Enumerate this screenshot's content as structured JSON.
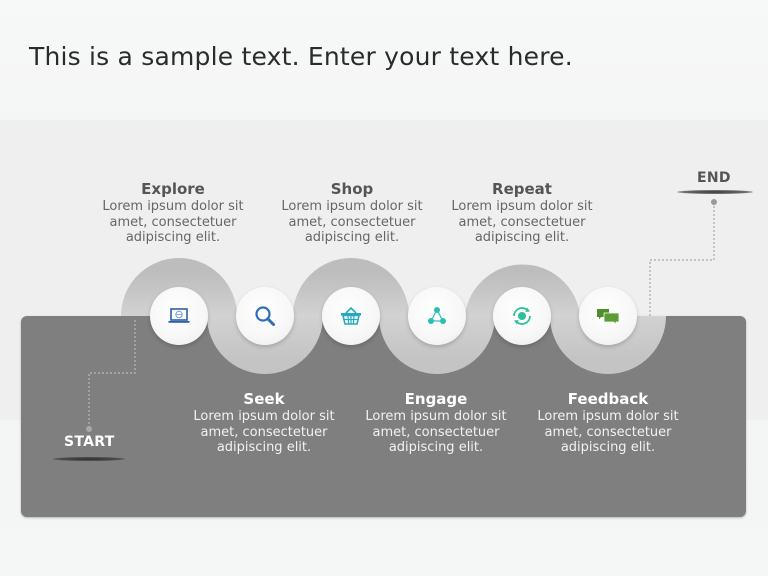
{
  "slide": {
    "title": "This is a sample text. Enter your text here."
  },
  "markers": {
    "start": "START",
    "end": "END"
  },
  "colors": {
    "panel": "#7f7f7f",
    "wave": "#c8c8c8",
    "icon_blue": "#2f6db5",
    "icon_teal": "#25b5c6",
    "icon_green_teal": "#2dbf9c",
    "icon_green": "#4d8f2b"
  },
  "steps": [
    {
      "title": "Explore",
      "body_lines": [
        "Lorem ipsum dolor sit",
        "amet, consectetuer",
        "adipiscing elit."
      ],
      "icon": "laptop-globe-icon",
      "position": "top"
    },
    {
      "title": "Seek",
      "body_lines": [
        "Lorem ipsum dolor sit",
        "amet, consectetuer",
        "adipiscing elit."
      ],
      "icon": "magnifier-icon",
      "position": "bottom"
    },
    {
      "title": "Shop",
      "body_lines": [
        "Lorem ipsum dolor sit",
        "amet, consectetuer",
        "adipiscing elit."
      ],
      "icon": "shopping-basket-icon",
      "position": "top"
    },
    {
      "title": "Engage",
      "body_lines": [
        "Lorem ipsum dolor sit",
        "amet, consectetuer",
        "adipiscing elit."
      ],
      "icon": "people-network-icon",
      "position": "bottom"
    },
    {
      "title": "Repeat",
      "body_lines": [
        "Lorem ipsum dolor sit",
        "amet, consectetuer",
        "adipiscing elit."
      ],
      "icon": "refresh-cycle-icon",
      "position": "top"
    },
    {
      "title": "Feedback",
      "body_lines": [
        "Lorem ipsum dolor sit",
        "amet, consectetuer",
        "adipiscing elit."
      ],
      "icon": "chat-bubbles-icon",
      "position": "bottom"
    }
  ]
}
